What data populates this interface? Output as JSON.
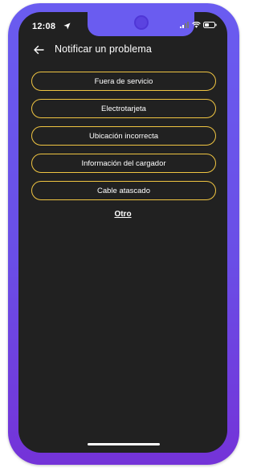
{
  "status_bar": {
    "time": "12:08",
    "icons": [
      "location-arrow-icon",
      "signal-icon",
      "wifi-icon",
      "battery-icon"
    ]
  },
  "header": {
    "back_icon": "arrow-left-icon",
    "title": "Notificar un problema"
  },
  "options": [
    {
      "label": "Fuera de servicio"
    },
    {
      "label": "Electrotarjeta"
    },
    {
      "label": "Ubicación incorrecta"
    },
    {
      "label": "Información del cargador"
    },
    {
      "label": "Cable atascado"
    }
  ],
  "other_link": "Otro",
  "colors": {
    "frame": "#6a5cf0",
    "frame_bottom": "#7433d8",
    "screen_background": "#212121",
    "button_border": "#f0c542",
    "text": "#ffffff"
  }
}
